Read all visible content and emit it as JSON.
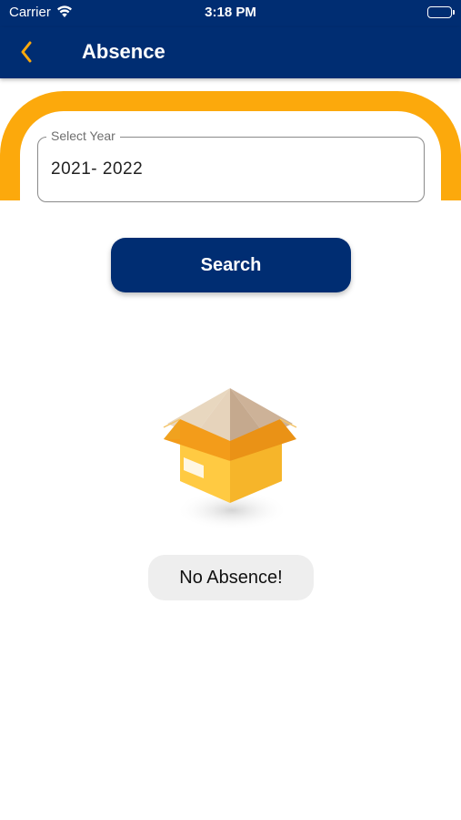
{
  "status_bar": {
    "carrier": "Carrier",
    "time": "3:18 PM",
    "icons": [
      "wifi-icon",
      "battery-icon"
    ]
  },
  "nav": {
    "title": "Absence",
    "back_icon": "chevron-left-icon"
  },
  "form": {
    "year_label": "Select Year",
    "year_value": "2021- 2022",
    "search_label": "Search"
  },
  "empty_state": {
    "icon": "empty-box-icon",
    "message": "No Absence!"
  },
  "colors": {
    "primary": "#002d72",
    "accent": "#fca90c",
    "background": "#ffffff",
    "message_bg": "#eeeeee"
  }
}
